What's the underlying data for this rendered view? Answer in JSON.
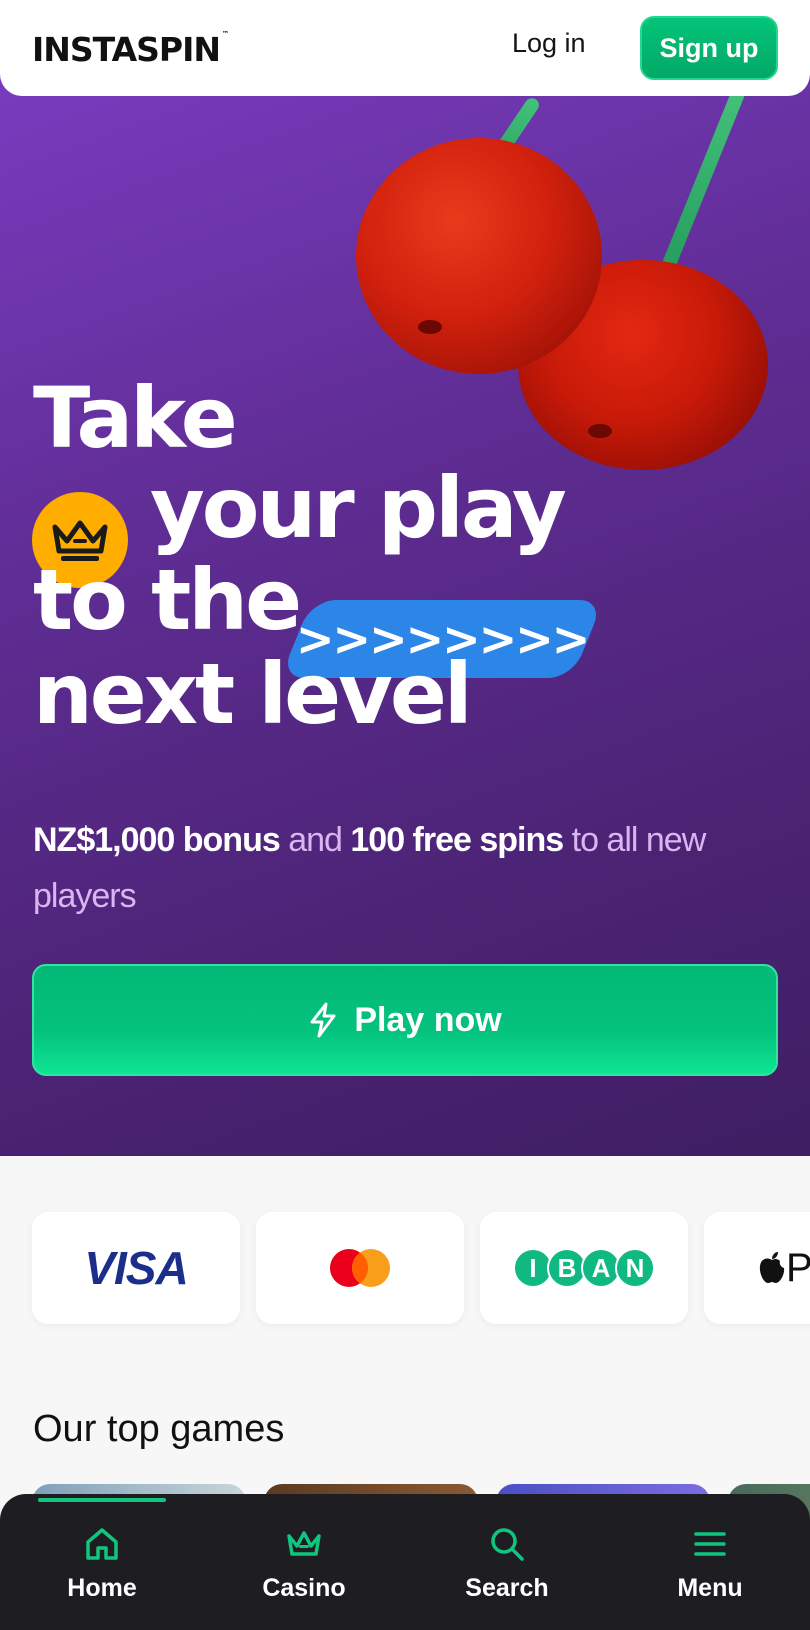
{
  "header": {
    "logo": "INSTASPIN",
    "logo_tm": "™",
    "login_label": "Log in",
    "signup_label": "Sign up"
  },
  "hero": {
    "line1": "Take",
    "line2": "your play",
    "line3": "to the",
    "line4": "next level",
    "arrows": ">>>>>>>>",
    "subtext": {
      "bonus": "NZ$1,000 bonus",
      "and": " and ",
      "spins": "100 free spins",
      "rest": " to all new players"
    },
    "play_label": "Play now"
  },
  "payments": {
    "visa": "VISA",
    "iban_letters": [
      "I",
      "B",
      "A",
      "N"
    ],
    "apple_pay": "Pay"
  },
  "top_games": {
    "title": "Our top games"
  },
  "bottom_nav": {
    "items": [
      {
        "label": "Home",
        "icon": "home-icon"
      },
      {
        "label": "Casino",
        "icon": "crown-icon"
      },
      {
        "label": "Search",
        "icon": "search-icon"
      },
      {
        "label": "Menu",
        "icon": "menu-icon"
      }
    ]
  },
  "colors": {
    "brand_green": "#04c47a",
    "hero_purple": "#5e2c92",
    "crown_yellow": "#ffae00",
    "arrow_blue": "#2b86e8"
  }
}
